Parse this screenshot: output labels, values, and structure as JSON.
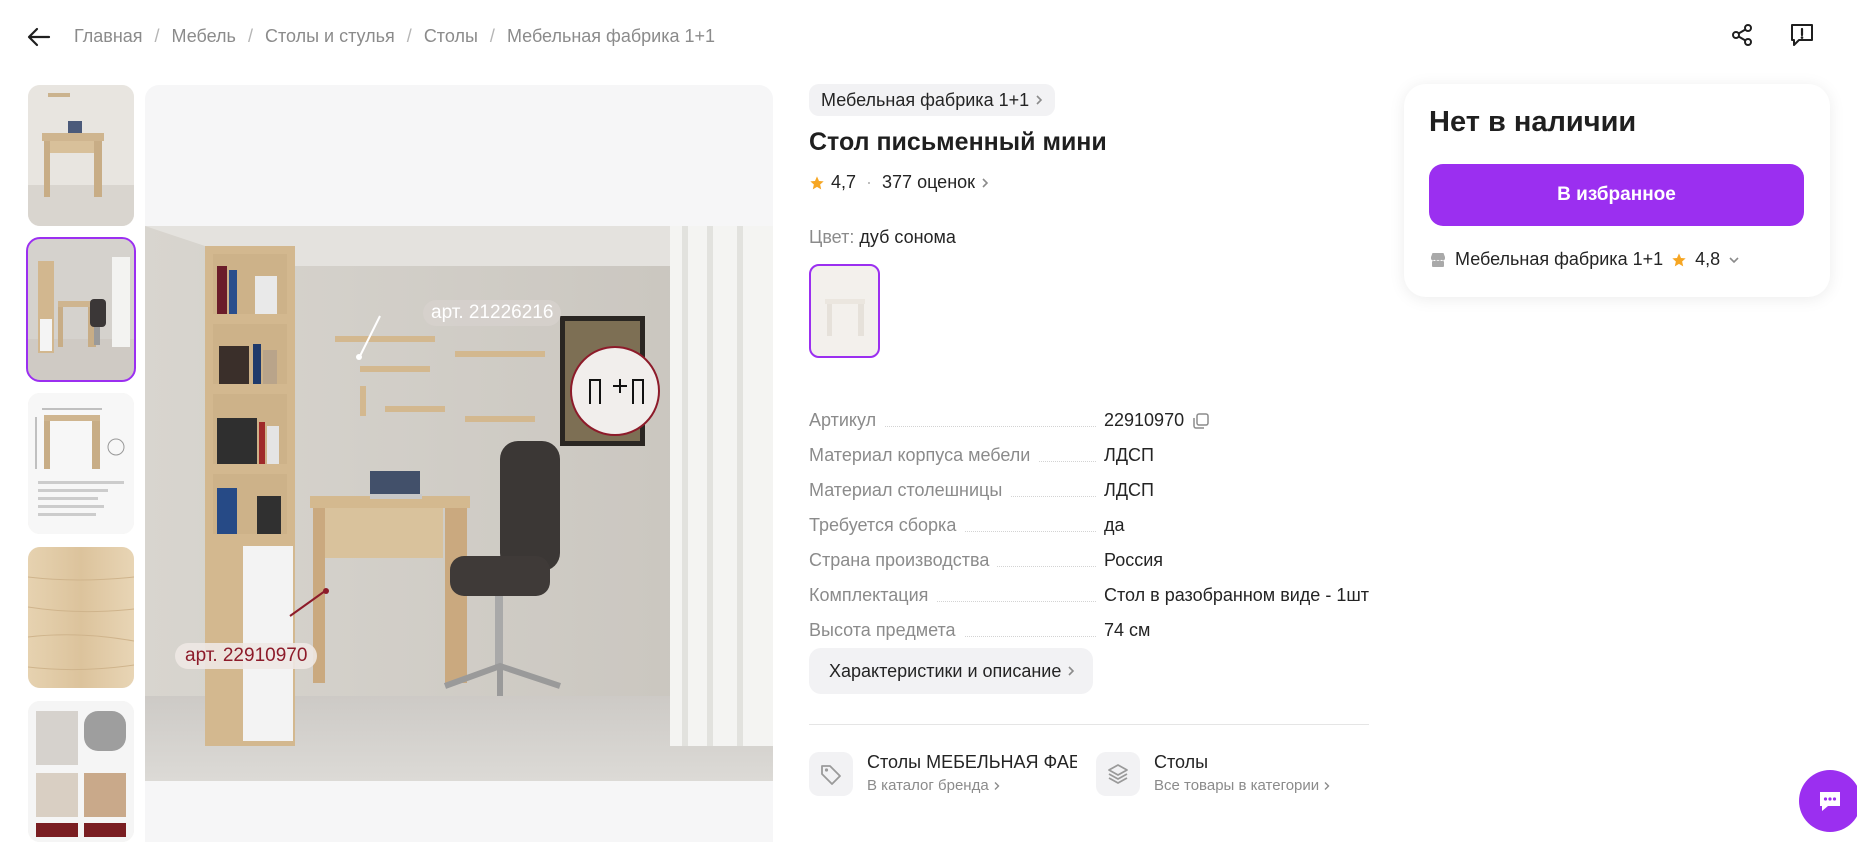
{
  "breadcrumbs": [
    "Главная",
    "Мебель",
    "Столы и стулья",
    "Столы",
    "Мебельная фабрика 1+1"
  ],
  "product": {
    "brand_chip": "Мебельная фабрика 1+1",
    "title": "Стол письменный мини",
    "rating": "4,7",
    "reviews": "377 оценок",
    "color_label": "Цвет:",
    "color_value": "дуб сонома"
  },
  "gallery": {
    "tag_top": "арт. 21226216",
    "tag_bottom": "арт. 22910970",
    "selected_thumb": 2
  },
  "specs": [
    {
      "key": "Артикул",
      "value": "22910970"
    },
    {
      "key": "Материал корпуса мебели",
      "value": "ЛДСП"
    },
    {
      "key": "Материал столешницы",
      "value": "ЛДСП"
    },
    {
      "key": "Требуется сборка",
      "value": "да"
    },
    {
      "key": "Страна производства",
      "value": "Россия"
    },
    {
      "key": "Комплектация",
      "value": "Стол в разобранном виде - 1шт"
    },
    {
      "key": "Высота предмета",
      "value": "74 см"
    }
  ],
  "details_button": "Характеристики и описание",
  "categories": [
    {
      "title": "Столы МЕБЕЛЬНАЯ ФАБРИ",
      "link": "В каталог бренда",
      "icon": "tag-icon"
    },
    {
      "title": "Столы",
      "link": "Все товары в категории",
      "icon": "layers-icon"
    }
  ],
  "buybox": {
    "status": "Нет в наличии",
    "fav_button": "В избранное",
    "seller": "Мебельная фабрика 1+1",
    "seller_rating": "4,8"
  },
  "colors": {
    "accent": "#9b2ff0",
    "star": "#f6a623",
    "muted": "#8b8b8b"
  }
}
